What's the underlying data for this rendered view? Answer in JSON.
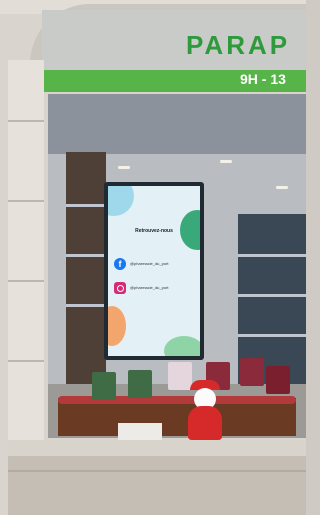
{
  "storefront": {
    "sign_text": "PARAP",
    "hours_text": "9H - 13",
    "colors": {
      "brand_green": "#56b448",
      "sign_text": "#2f9a3c"
    }
  },
  "screen": {
    "title": "Retrouvez-nous",
    "facebook": {
      "icon": "facebook-icon",
      "handle": "@pharmacie_du_port"
    },
    "instagram": {
      "icon": "instagram-icon",
      "handle": "@pharmacie_du_port"
    }
  }
}
